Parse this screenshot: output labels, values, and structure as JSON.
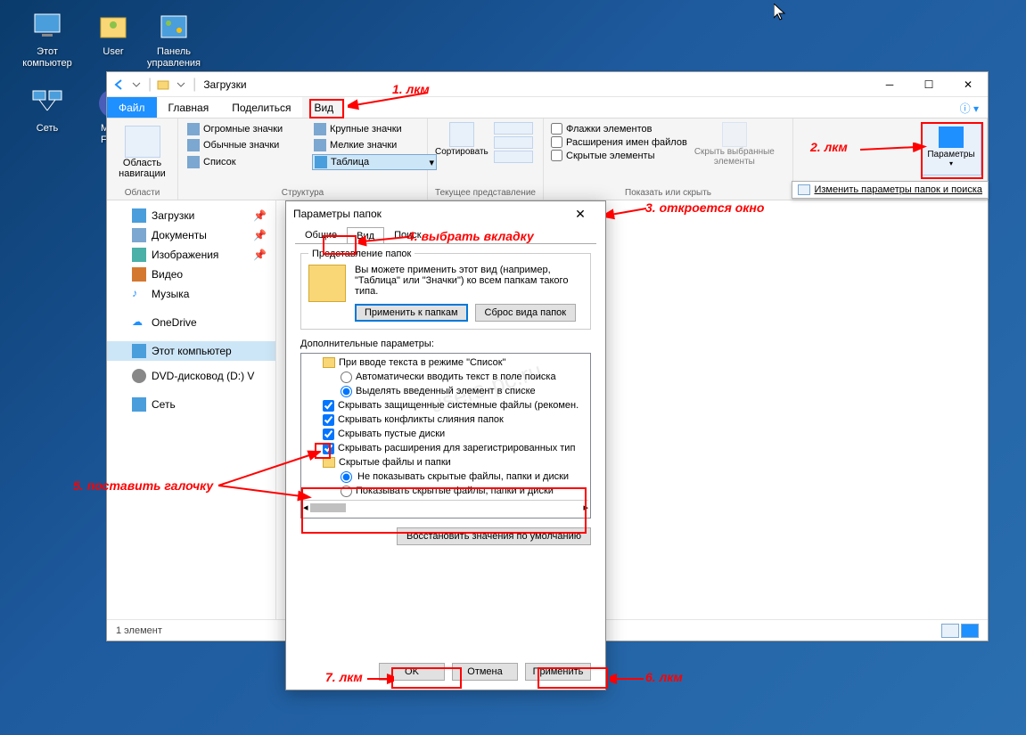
{
  "desktop": {
    "icons": [
      {
        "label": "Этот\nкомпьютер"
      },
      {
        "label": "User"
      },
      {
        "label": "Панель\nуправления"
      },
      {
        "label": "Сеть"
      },
      {
        "label": "Mozill\nFirefo"
      }
    ]
  },
  "explorer": {
    "title": "Загрузки",
    "menu": {
      "file": "Файл",
      "home": "Главная",
      "share": "Поделиться",
      "view": "Вид"
    },
    "ribbon": {
      "nav_label": "Область\nнавигации",
      "group_nav": "Области",
      "views": {
        "huge": "Огромные значки",
        "large": "Крупные значки",
        "medium": "Обычные значки",
        "small": "Мелкие значки",
        "list": "Список",
        "table": "Таблица"
      },
      "group_struct": "Структура",
      "sort": "Сортировать",
      "group_current": "Текущее представление",
      "check_items": "Флажки элементов",
      "check_ext": "Расширения имен файлов",
      "check_hidden": "Скрытые элементы",
      "hide_sel": "Скрыть выбранные\nэлементы",
      "group_show": "Показать или скрыть",
      "params": "Параметры",
      "tooltip": "Изменить параметры папок и поиска"
    },
    "nav": {
      "downloads": "Загрузки",
      "documents": "Документы",
      "images": "Изображения",
      "video": "Видео",
      "music": "Музыка",
      "onedrive": "OneDrive",
      "thispc": "Этот компьютер",
      "dvd": "DVD-дисковод (D:) V",
      "network": "Сеть"
    },
    "status": "1 элемент"
  },
  "dialog": {
    "title": "Параметры папок",
    "tabs": {
      "general": "Общие",
      "view": "Вид",
      "search": "Поиск"
    },
    "folder_view": {
      "legend": "Представление папок",
      "text": "Вы можете применить этот вид (например, \"Таблица\" или \"Значки\") ко всем папкам такого типа.",
      "apply_btn": "Применить к папкам",
      "reset_btn": "Сброс вида папок"
    },
    "advanced": {
      "label": "Дополнительные параметры:",
      "list_mode": "При вводе текста в режиме \"Список\"",
      "auto_text": "Автоматически вводить текст в поле поиска",
      "highlight": "Выделять введенный элемент в списке",
      "hide_sys": "Скрывать защищенные системные файлы (рекомен.",
      "hide_conflict": "Скрывать конфликты слияния папок",
      "hide_empty": "Скрывать пустые диски",
      "hide_ext": "Скрывать расширения для зарегистрированных тип",
      "hidden_folder": "Скрытые файлы и папки",
      "hidden_no": "Не показывать скрытые файлы, папки и диски",
      "hidden_yes": "Показывать скрытые файлы, папки и диски"
    },
    "restore": "Восстановить значения по умолчанию",
    "ok": "OK",
    "cancel": "Отмена",
    "apply": "Применить"
  },
  "annotations": {
    "a1": "1. лкм",
    "a2": "2. лкм",
    "a3": "3. откроется окно",
    "a4": "4. выбрать вкладку",
    "a5": "5. поставить галочку",
    "a6": "6. лкм",
    "a7": "7. лкм"
  }
}
